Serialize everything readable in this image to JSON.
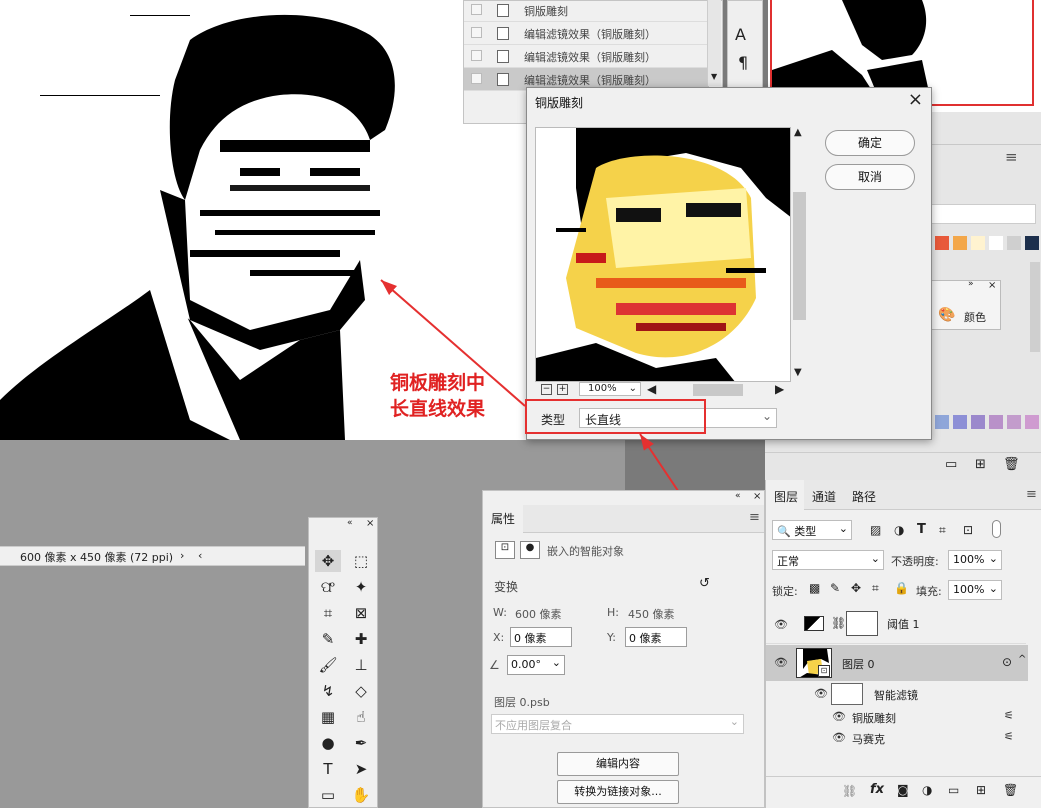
{
  "history": {
    "items": [
      {
        "label": "铜版雕刻"
      },
      {
        "label": "编辑滤镜效果（铜版雕刻）"
      },
      {
        "label": "编辑滤镜效果（铜版雕刻）"
      },
      {
        "label": "编辑滤镜效果（铜版雕刻）"
      }
    ]
  },
  "char_strip": {
    "text_tool": "A",
    "para_tool": "¶"
  },
  "status": {
    "doc_size": "600 像素 x 450 像素 (72 ppi)"
  },
  "dialog": {
    "title": "铜版雕刻",
    "ok": "确定",
    "cancel": "取消",
    "zoom": "100%",
    "type_label": "类型",
    "type_value": "长直线"
  },
  "annotation": {
    "line1": "铜板雕刻中",
    "line2": "长直线效果"
  },
  "adjust_panel": {
    "color_label": "颜色"
  },
  "properties": {
    "tab": "属性",
    "kind": "嵌入的智能对象",
    "transform": "变换",
    "w_label": "W:",
    "w_value": "600 像素",
    "h_label": "H:",
    "h_value": "450 像素",
    "x_label": "X:",
    "x_value": "0 像素",
    "y_label": "Y:",
    "y_value": "0 像素",
    "angle": "0.00°",
    "file": "图层 0.psb",
    "comp_placeholder": "不应用图层复合",
    "edit_btn": "编辑内容",
    "convert_btn": "转换为链接对象..."
  },
  "layers": {
    "tabs": [
      "图层",
      "通道",
      "路径"
    ],
    "filter_kind": "类型",
    "blend": "正常",
    "opacity_label": "不透明度:",
    "opacity": "100%",
    "lock_label": "锁定:",
    "fill_label": "填充:",
    "fill": "100%",
    "rows": {
      "threshold": "阈值 1",
      "layer0": "图层 0",
      "smart_filters": "智能滤镜",
      "copper": "铜版雕刻",
      "mosaic": "马赛克"
    },
    "swatches": [
      "#e8593a",
      "#f3a74a",
      "#fff3d0",
      "#ffffff",
      "#cfcfcf",
      "#1c2f4c"
    ],
    "swatches2": [
      "#8fa6d9",
      "#8d8fd6",
      "#9b88cc",
      "#b991c9",
      "#c39ccc",
      "#cf9bd0"
    ]
  }
}
